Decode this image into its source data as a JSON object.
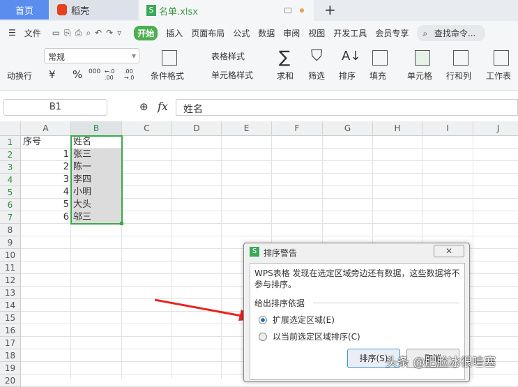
{
  "tabs": [
    {
      "label": "首页"
    },
    {
      "label": "稻壳"
    },
    {
      "label": "名单.xlsx"
    }
  ],
  "menu": {
    "file": "文件",
    "items": [
      "开始",
      "插入",
      "页面布局",
      "公式",
      "数据",
      "审阅",
      "视图",
      "开发工具",
      "会员专享"
    ],
    "search": "查找命令..."
  },
  "ribbon": {
    "wrap": "动换行",
    "format": "常规",
    "currency": "¥",
    "percent": "%",
    "thousands": "000",
    "dec_inc": "←.0 .00",
    "dec_dec": ".00 →.0",
    "cond": "条件格式",
    "table_style": "表格样式",
    "cell_style": "单元格样式",
    "sum": "求和",
    "filter": "筛选",
    "sort": "排序",
    "fill": "填充",
    "cell": "单元格",
    "rowcol": "行和列",
    "sheet": "工作表"
  },
  "formula": {
    "ref": "B1",
    "fx": "fx",
    "value": "姓名"
  },
  "columns": [
    "A",
    "B",
    "C",
    "D",
    "E",
    "F",
    "G",
    "H",
    "I",
    "J"
  ],
  "rows": [
    "1",
    "2",
    "3",
    "4",
    "5",
    "6",
    "7",
    "8",
    "9",
    "10",
    "11",
    "12",
    "13",
    "14",
    "15",
    "16",
    "17",
    "18",
    "19",
    "20"
  ],
  "cells": {
    "A1": "序号",
    "B1": "姓名",
    "A": [
      "1",
      "2",
      "3",
      "4",
      "5",
      "6"
    ],
    "B": [
      "张三",
      "陈一",
      "李四",
      "小明",
      "大头",
      "邬三"
    ]
  },
  "dialog": {
    "title": "排序警告",
    "message": "WPS表格 发现在选定区域旁边还有数据，这些数据将不参与排序。",
    "group": "给出排序依据",
    "opt1": "扩展选定区域(E)",
    "opt2": "以当前选定区域排序(C)",
    "ok": "排序(S)",
    "cancel": "取消",
    "opt1_selected": true
  },
  "watermark": "头条 @肥脸冰很哇塞",
  "colors": {
    "accent": "#4caf50",
    "tab_home": "#5b8def",
    "arrow": "#e8231f"
  }
}
